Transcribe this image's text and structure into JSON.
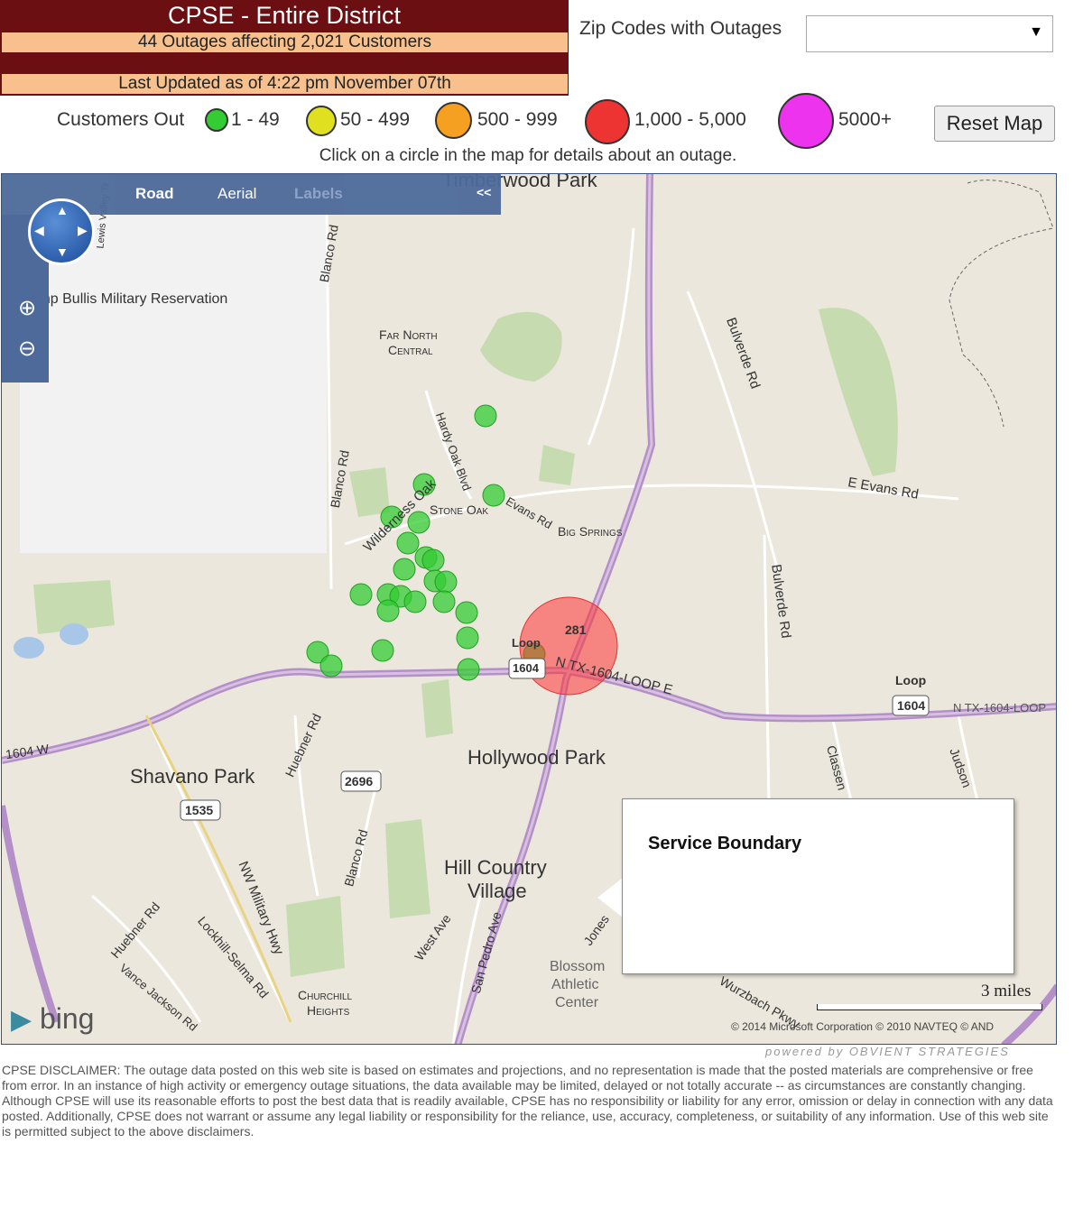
{
  "header": {
    "title": "CPSE - Entire District",
    "outage_summary": "44 Outages affecting 2,021 Customers",
    "last_updated": "Last Updated as of 4:22 pm November 07th"
  },
  "zip_filter": {
    "label": "Zip Codes with Outages",
    "selected": ""
  },
  "legend": {
    "label": "Customers Out",
    "items": [
      {
        "range": "1 - 49",
        "color": "#33cc33"
      },
      {
        "range": "50 - 499",
        "color": "#e0e020"
      },
      {
        "range": "500 - 999",
        "color": "#f5a020"
      },
      {
        "range": "1,000 - 5,000",
        "color": "#ee3333"
      },
      {
        "range": "5000+",
        "color": "#ee33ee"
      }
    ]
  },
  "reset_label": "Reset Map",
  "hint": "Click on a circle in the map for details about an outage.",
  "map": {
    "tabs": [
      "Road",
      "Aerial",
      "Labels"
    ],
    "collapse": "<<",
    "popup_title": "Service Boundary",
    "scale": "3 miles",
    "provider": "bing",
    "copyright": "© 2014 Microsoft Corporation   © 2010 NAVTEQ  © AND",
    "places": {
      "timberwood": "Timberwood Park",
      "camp_bullis": "Camp Bullis Military Reservation",
      "far_north": "Far North",
      "far_north_2": "Central",
      "stone_oak": "Stone Oak",
      "big_springs": "Big Springs",
      "hollywood": "Hollywood Park",
      "shavano": "Shavano Park",
      "hill_country": "Hill Country",
      "hill_country_2": "Village",
      "blossom": "Blossom",
      "blossom_2": "Athletic",
      "blossom_3": "Center",
      "churchill": "Churchill",
      "churchill_2": "Heights"
    },
    "roads": {
      "bulverde": "Bulverde Rd",
      "bulverde2": "Bulverde Rd",
      "evans": "E Evans Rd",
      "evans2": "Evans Rd",
      "blanco1": "Blanco Rd",
      "blanco2": "Blanco Rd",
      "blanco3": "Blanco Rd",
      "hardy": "Hardy Oak Blvd",
      "wilderness": "Wilderness Oak",
      "loop1": "Loop",
      "loop_num": "1604",
      "loop2": "Loop",
      "loop_num2": "1604",
      "n1604": "N TX-1604-LOOP E",
      "n1604b": "N TX-1604-LOOP",
      "w1604": "1604 W",
      "hwy281": "281",
      "fm2696": "2696",
      "fm1535": "1535",
      "huebner": "Huebner Rd",
      "huebner2": "Huebner Rd",
      "military": "NW Military Hwy",
      "lockhill": "Lockhill-Selma Rd",
      "vance": "Vance Jackson Rd",
      "westave": "West Ave",
      "sanpedro": "San Pedro Ave",
      "jones": "Jones",
      "wurzbach": "Wurzbach Pkwy",
      "classen": "Classen",
      "judson": "Judson",
      "lewis": "Lewis Valley Tr"
    }
  },
  "outages": [
    {
      "customers_band": "1,000 - 5,000"
    },
    {
      "customers_band": "1 - 49"
    }
  ],
  "powered_by": "powered by OBVIENT STRATEGIES",
  "disclaimer": "CPSE DISCLAIMER:  The outage data posted on this web site is based on estimates and projections, and no representation is made that the posted materials are comprehensive or free from error.  In an instance of high activity or emergency outage situations, the data available may be limited, delayed or not totally accurate -- as circumstances are constantly changing.  Although CPSE will use its reasonable efforts to post the best data that is readily available, CPSE has no responsibility or liability for any error, omission or delay in connection with any data posted.  Additionally, CPSE does not warrant or assume any legal liability or responsibility for the reliance, use, accuracy, completeness, or suitability of any information.  Use of this web site is permitted subject to the above disclaimers."
}
